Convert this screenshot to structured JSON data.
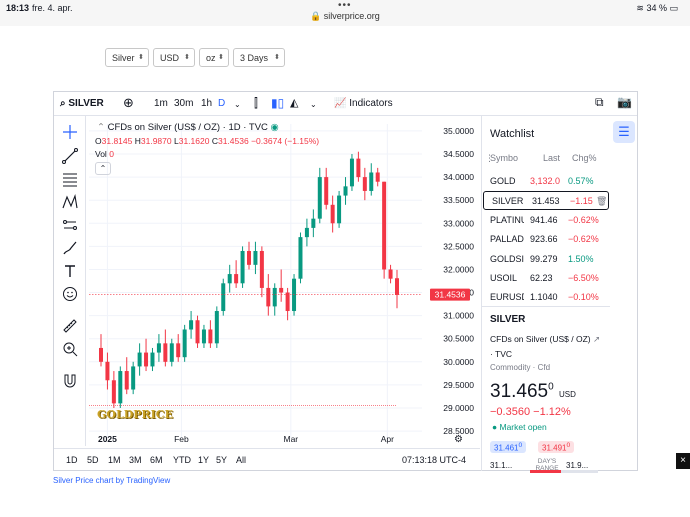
{
  "status_bar": {
    "time": "18:13",
    "date": "fre. 4. apr.",
    "url": "silverprice.org",
    "battery": "34 %"
  },
  "selectors": [
    {
      "value": "Silver"
    },
    {
      "value": "USD"
    },
    {
      "value": "oz"
    },
    {
      "value": "3 Days"
    }
  ],
  "toolbar": {
    "symbol": "SILVER",
    "intervals": [
      "1m",
      "30m",
      "1h",
      "D"
    ],
    "indicators_label": "Indicators"
  },
  "legend": {
    "title": "CFDs on Silver (US$ / OZ) · 1D · TVC",
    "o_label": "O",
    "o_value": "31.8145",
    "h_label": "H",
    "h_value": "31.9870",
    "l_label": "L",
    "l_value": "31.1620",
    "c_label": "C",
    "c_value": "31.4536",
    "change": "−0.3674 (−1.15%)",
    "vol_label": "Vol",
    "vol_value": "0"
  },
  "chart_data": {
    "type": "candlestick",
    "y_ticks": [
      "35.0000",
      "34.5000",
      "34.0000",
      "33.5000",
      "33.0000",
      "32.5000",
      "32.0000",
      "31.5000",
      "31.0000",
      "30.5000",
      "30.0000",
      "29.5000",
      "29.0000",
      "28.5000"
    ],
    "ylim": [
      28.35,
      35.15
    ],
    "x_ticks": [
      "2025",
      "Feb",
      "Mar",
      "Apr"
    ],
    "last_price": "31.4536",
    "candles": [
      [
        30.3,
        30.6,
        29.9,
        30.0
      ],
      [
        30.0,
        30.2,
        29.4,
        29.6
      ],
      [
        29.6,
        29.8,
        29.0,
        29.1
      ],
      [
        29.1,
        29.9,
        29.0,
        29.8
      ],
      [
        29.8,
        30.1,
        29.3,
        29.4
      ],
      [
        29.4,
        30.0,
        29.3,
        29.9
      ],
      [
        29.9,
        30.4,
        29.7,
        30.2
      ],
      [
        30.2,
        30.5,
        29.8,
        29.9
      ],
      [
        29.9,
        30.3,
        29.8,
        30.2
      ],
      [
        30.2,
        30.6,
        30.0,
        30.4
      ],
      [
        30.4,
        30.7,
        29.9,
        30.0
      ],
      [
        30.0,
        30.5,
        29.9,
        30.4
      ],
      [
        30.4,
        30.6,
        30.0,
        30.1
      ],
      [
        30.1,
        30.8,
        30.0,
        30.7
      ],
      [
        30.7,
        31.1,
        30.5,
        30.9
      ],
      [
        30.9,
        31.0,
        30.3,
        30.4
      ],
      [
        30.4,
        30.8,
        30.3,
        30.7
      ],
      [
        30.7,
        30.9,
        30.3,
        30.4
      ],
      [
        30.4,
        31.2,
        30.3,
        31.1
      ],
      [
        31.1,
        31.8,
        31.0,
        31.7
      ],
      [
        31.7,
        32.1,
        31.5,
        31.9
      ],
      [
        31.9,
        32.2,
        31.6,
        31.7
      ],
      [
        31.7,
        32.5,
        31.6,
        32.4
      ],
      [
        32.4,
        32.6,
        32.0,
        32.1
      ],
      [
        32.1,
        32.6,
        31.9,
        32.4
      ],
      [
        32.4,
        32.5,
        31.4,
        31.6
      ],
      [
        31.6,
        31.9,
        31.0,
        31.2
      ],
      [
        31.2,
        31.7,
        31.0,
        31.6
      ],
      [
        31.6,
        32.0,
        31.3,
        31.5
      ],
      [
        31.5,
        31.6,
        30.9,
        31.1
      ],
      [
        31.1,
        31.9,
        31.0,
        31.8
      ],
      [
        31.8,
        32.8,
        31.7,
        32.7
      ],
      [
        32.7,
        33.1,
        32.5,
        32.9
      ],
      [
        32.9,
        33.3,
        32.7,
        33.1
      ],
      [
        33.1,
        34.2,
        33.0,
        34.0
      ],
      [
        34.0,
        34.2,
        33.3,
        33.4
      ],
      [
        33.4,
        33.6,
        32.8,
        33.0
      ],
      [
        33.0,
        33.7,
        32.9,
        33.6
      ],
      [
        33.6,
        34.0,
        33.4,
        33.8
      ],
      [
        33.8,
        34.5,
        33.7,
        34.4
      ],
      [
        34.4,
        34.55,
        33.9,
        34.0
      ],
      [
        34.0,
        34.2,
        33.5,
        33.7
      ],
      [
        33.7,
        34.3,
        33.6,
        34.1
      ],
      [
        34.1,
        34.2,
        33.8,
        33.9
      ],
      [
        33.9,
        33.9,
        31.8,
        32.0
      ],
      [
        32.0,
        32.1,
        31.7,
        31.8
      ],
      [
        31.81,
        31.99,
        31.16,
        31.45
      ]
    ]
  },
  "watchlist": {
    "title": "Watchlist",
    "headers": {
      "symbol": "Symbol",
      "last": "Last",
      "chg": "Chg%"
    },
    "rows": [
      {
        "symbol": "GOLD",
        "last": "3,132.0",
        "chg": "0.57%",
        "dir": "up"
      },
      {
        "symbol": "SILVER",
        "last": "31.453",
        "chg": "−1.15",
        "dir": "down"
      },
      {
        "symbol": "PLATINUM",
        "last": "941.46",
        "chg": "−0.62%",
        "dir": "down"
      },
      {
        "symbol": "PALLADIUM",
        "last": "923.66",
        "chg": "−0.62%",
        "dir": "down"
      },
      {
        "symbol": "GOLDSILVER",
        "last": "99.279",
        "chg": "1.50%",
        "dir": "up"
      },
      {
        "symbol": "USOIL",
        "last": "62.23",
        "chg": "−6.50%",
        "dir": "down"
      },
      {
        "symbol": "EURUSD",
        "last": "1.1040",
        "chg": "−0.10%",
        "dir": "down"
      }
    ]
  },
  "details": {
    "symbol": "SILVER",
    "description": "CFDs on Silver (US$ / OZ)",
    "exchange": "TVC",
    "category": "Commodity · Cfd",
    "price_main": "31.465",
    "price_sup": "0",
    "currency": "USD",
    "change": "−0.3560",
    "change_pct": "−1.12%",
    "market_status": "Market open",
    "bid": "31.461",
    "bid_sup": "0",
    "ask": "31.491",
    "ask_sup": "0",
    "range_low": "31.1...",
    "range_label": "DAY'S RANGE",
    "range_high": "31.9..."
  },
  "bottom": {
    "ranges": [
      "1D",
      "5D",
      "1M",
      "3M",
      "6M",
      "YTD",
      "1Y",
      "5Y",
      "All"
    ],
    "clock": "07:13:18 UTC-4"
  },
  "watermark": "GOLDPRICE",
  "caption": "Silver Price chart by TradingView",
  "colors": {
    "up": "#089981",
    "down": "#f23645",
    "accent": "#2962ff"
  }
}
